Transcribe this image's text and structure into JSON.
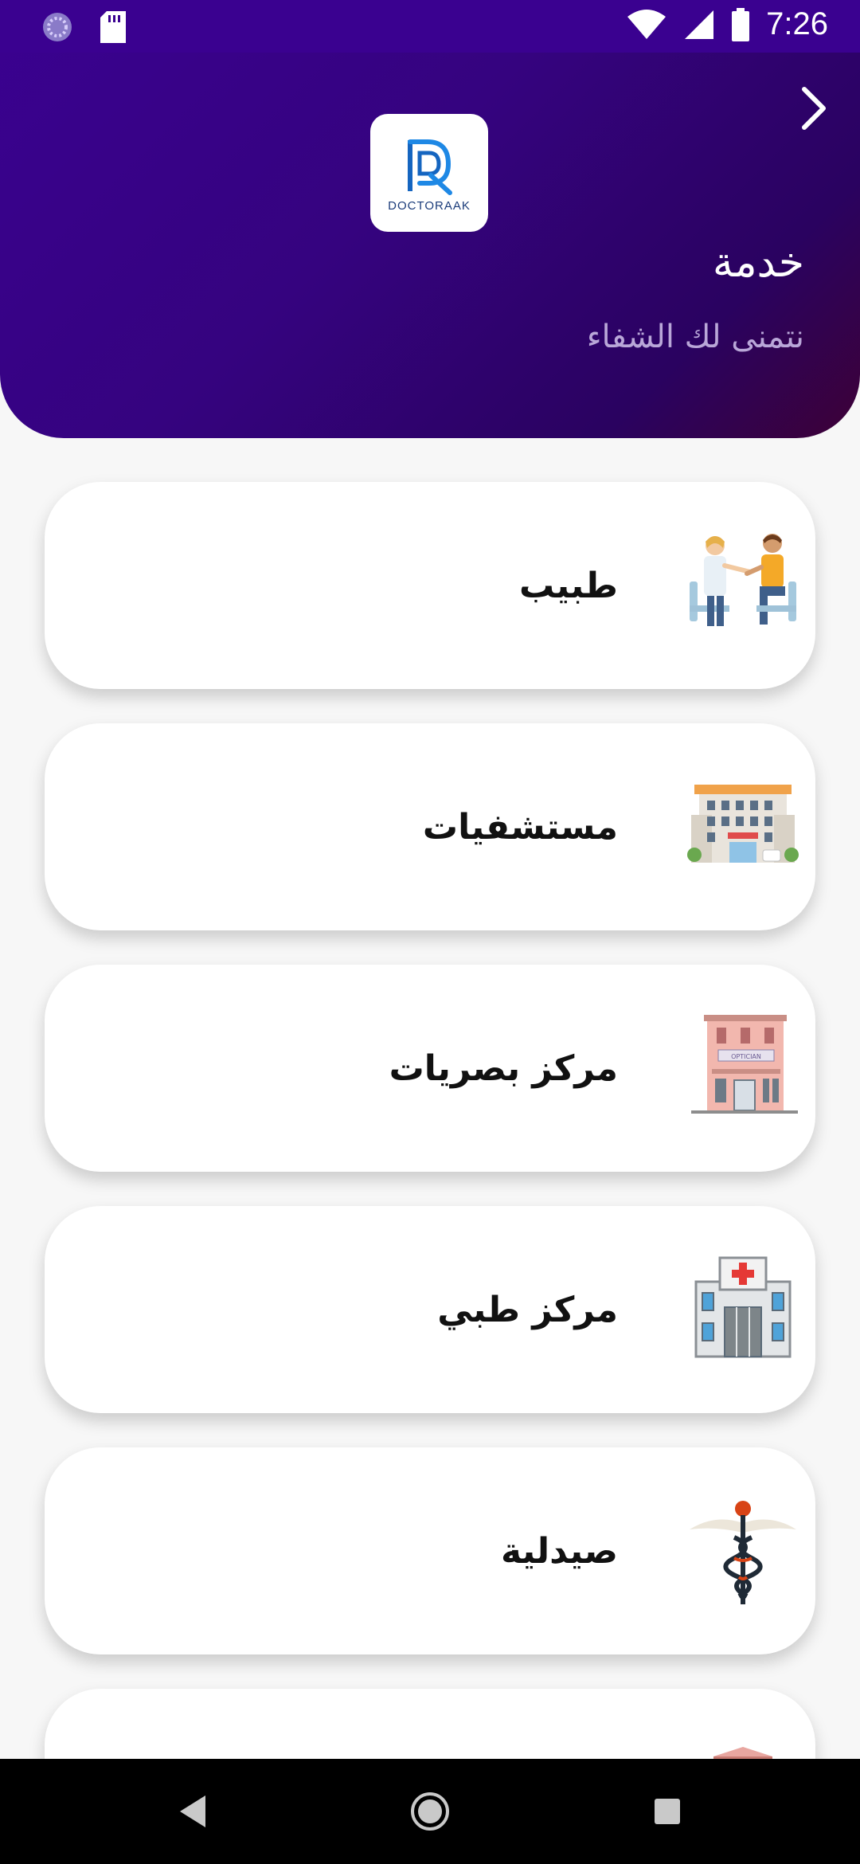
{
  "status_bar": {
    "time": "7:26",
    "icons": [
      "loader-icon",
      "sd-card-icon",
      "wifi-icon",
      "signal-icon",
      "battery-icon"
    ]
  },
  "header": {
    "title": "خدمة",
    "subtitle": "نتمنى لك الشفاء",
    "logo_text": "DOCTORAAK",
    "back_icon": "chevron-right-icon",
    "colors": {
      "gradient_start": "#3a0190",
      "gradient_end": "#3d0136"
    }
  },
  "services": [
    {
      "label": "طبيب",
      "icon": "doctor-patient-icon"
    },
    {
      "label": "مستشفيات",
      "icon": "hospital-building-icon"
    },
    {
      "label": "مركز بصريات",
      "icon": "optician-store-icon"
    },
    {
      "label": "مركز طبي",
      "icon": "medical-center-icon"
    },
    {
      "label": "صيدلية",
      "icon": "caduceus-icon"
    },
    {
      "label": "",
      "icon": "building-icon"
    }
  ],
  "nav_bar": {
    "icons": [
      "back-triangle-icon",
      "home-circle-icon",
      "recent-square-icon"
    ]
  }
}
